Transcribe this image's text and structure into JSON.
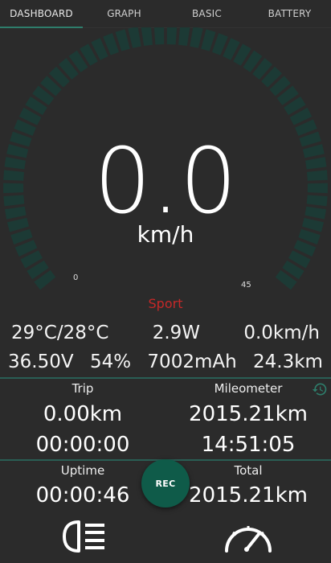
{
  "tabs": [
    "DASHBOARD",
    "GRAPH",
    "BASIC",
    "BATTERY"
  ],
  "active_tab": "DASHBOARD",
  "gauge": {
    "speed": "0.0",
    "unit": "km/h",
    "scale_min": "0",
    "scale_max": "45",
    "mode": "Sport",
    "active_color": "#00e0b0",
    "inactive_color": "#1c3a35",
    "level": 0
  },
  "stats": {
    "temperature": "29°C/28°C",
    "power": "2.9W",
    "speed_alt": "0.0km/h",
    "voltage": "36.50V",
    "battery_pct": "54%",
    "capacity": "7002mAh",
    "range": "24.3km"
  },
  "trip": {
    "trip_label": "Trip",
    "trip_distance": "0.00km",
    "trip_time": "00:00:00",
    "mileometer_label": "Mileometer",
    "mileometer_value": "2015.21km",
    "clock": "14:51:05",
    "uptime_label": "Uptime",
    "uptime_value": "00:00:46",
    "total_label": "Total",
    "total_value": "2015.21km"
  },
  "rec_label": "REC",
  "colors": {
    "accent": "#2e7d6b",
    "mode_red": "#c62828",
    "background": "#2b2b2b"
  },
  "icons": {
    "history": "history-icon",
    "headlight": "headlight-icon",
    "speedometer": "speedometer-icon"
  }
}
